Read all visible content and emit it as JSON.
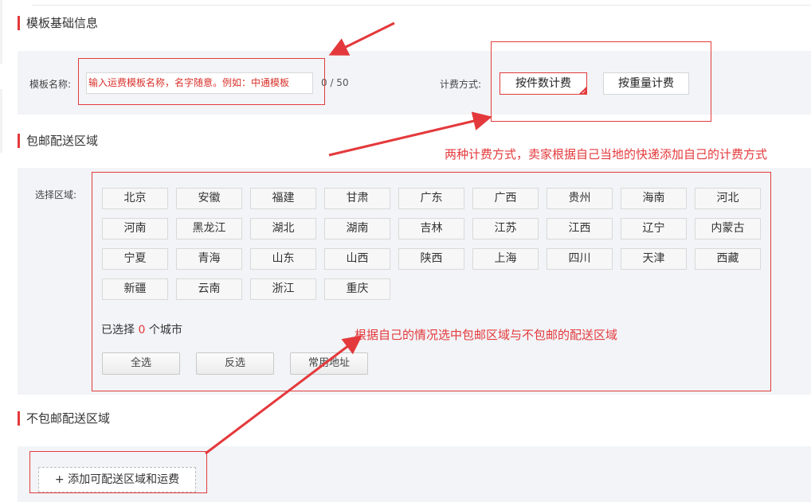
{
  "sections": {
    "basic_info": "模板基础信息",
    "free_area": "包邮配送区域",
    "nonfree_area": "不包邮配送区域"
  },
  "template_name": {
    "label": "模板名称:",
    "placeholder": "输入运费模板名称，名字随意。例如：中通模板",
    "counter": "0 / 50"
  },
  "fee_mode": {
    "label": "计费方式:",
    "options": [
      "按件数计费",
      "按重量计费"
    ],
    "selected": "按件数计费"
  },
  "region_select": {
    "label": "选择区域:",
    "provinces": [
      "北京",
      "安徽",
      "福建",
      "甘肃",
      "广东",
      "广西",
      "贵州",
      "海南",
      "河北",
      "河南",
      "黑龙江",
      "湖北",
      "湖南",
      "吉林",
      "江苏",
      "江西",
      "辽宁",
      "内蒙古",
      "宁夏",
      "青海",
      "山东",
      "山西",
      "陕西",
      "上海",
      "四川",
      "天津",
      "西藏",
      "新疆",
      "云南",
      "浙江",
      "重庆"
    ],
    "selected_prefix": "已选择",
    "selected_count": "0",
    "selected_suffix": "个城市",
    "buttons": {
      "select_all": "全选",
      "invert": "反选",
      "common": "常用地址"
    }
  },
  "add_area_button": "+ 添加可配送区域和运费",
  "annotations": {
    "fee_note": "两种计费方式，卖家根据自己当地的快递添加自己的计费方式",
    "region_note": "根据自己的情况选中包邮区域与不包邮的配送区域"
  },
  "colors": {
    "accent": "#e4393c",
    "panel_bg": "#f2f4f7"
  }
}
